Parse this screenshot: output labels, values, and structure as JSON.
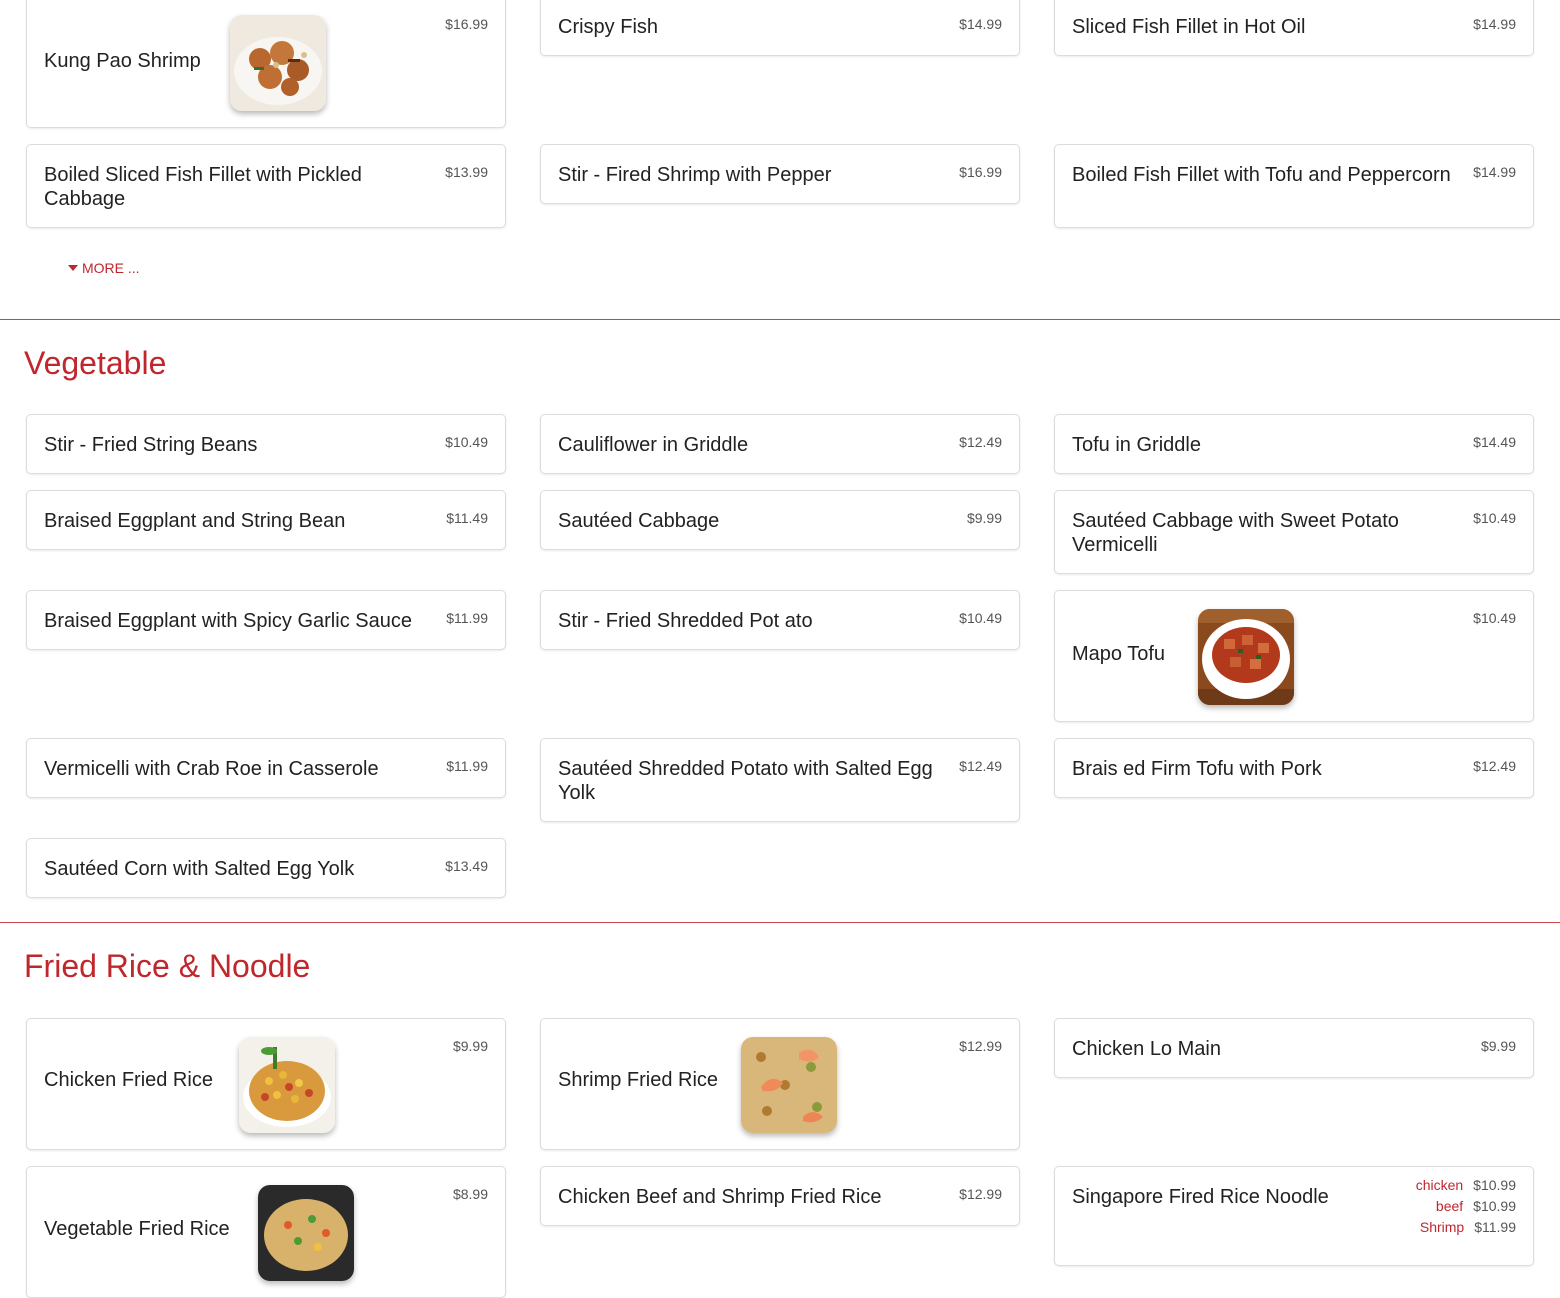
{
  "seafood_tail": {
    "items": [
      {
        "name": "Kung Pao Shrimp",
        "price": "$16.99"
      },
      {
        "name": "Crispy Fish",
        "price": "$14.99"
      },
      {
        "name": "Sliced Fish Fillet in Hot Oil",
        "price": "$14.99"
      },
      {
        "name": "Boiled Sliced Fish Fillet with Pickled Cabbage",
        "price": "$13.99"
      },
      {
        "name": "Stir - Fired Shrimp with Pepper",
        "price": "$16.99"
      },
      {
        "name": "Boiled Fish Fillet with Tofu and Peppercorn",
        "price": "$14.99"
      }
    ],
    "more_label": "MORE ..."
  },
  "vegetable": {
    "title": "Vegetable",
    "items": [
      {
        "name": "Stir - Fried String Beans",
        "price": "$10.49"
      },
      {
        "name": "Cauliflower in Griddle",
        "price": "$12.49"
      },
      {
        "name": "Tofu in Griddle",
        "price": "$14.49"
      },
      {
        "name": "Braised Eggplant and String Bean",
        "price": "$11.49"
      },
      {
        "name": "Sautéed Cabbage",
        "price": "$9.99"
      },
      {
        "name": "Sautéed Cabbage with Sweet Potato Vermicelli",
        "price": "$10.49"
      },
      {
        "name": "Braised Eggplant with Spicy Garlic Sauce",
        "price": "$11.99"
      },
      {
        "name": "Stir - Fried Shredded Pot ato",
        "price": "$10.49"
      },
      {
        "name": "Mapo Tofu",
        "price": "$10.49"
      },
      {
        "name": "Vermicelli with Crab Roe in Casserole",
        "price": "$11.99"
      },
      {
        "name": "Sautéed Shredded Potato with Salted Egg Yolk",
        "price": "$12.49"
      },
      {
        "name": "Brais ed Firm Tofu with Pork",
        "price": "$12.49"
      },
      {
        "name": "Sautéed Corn with Salted Egg Yolk",
        "price": "$13.49"
      }
    ]
  },
  "fried_rice": {
    "title": "Fried Rice & Noodle",
    "items": [
      {
        "name": "Chicken Fried Rice",
        "price": "$9.99"
      },
      {
        "name": "Shrimp Fried Rice",
        "price": "$12.99"
      },
      {
        "name": "Chicken Lo Main",
        "price": "$9.99"
      },
      {
        "name": "Vegetable Fried Rice",
        "price": "$8.99"
      },
      {
        "name": "Chicken Beef and Shrimp Fried Rice",
        "price": "$12.99"
      },
      {
        "name": "Singapore Fired Rice Noodle",
        "variants": [
          {
            "label": "chicken",
            "price": "$10.99"
          },
          {
            "label": "beef",
            "price": "$10.99"
          },
          {
            "label": "Shrimp",
            "price": "$11.99"
          }
        ]
      }
    ]
  },
  "colors": {
    "accent": "#c0272d",
    "card_border": "#dcdcdc",
    "price_text": "#555555"
  }
}
